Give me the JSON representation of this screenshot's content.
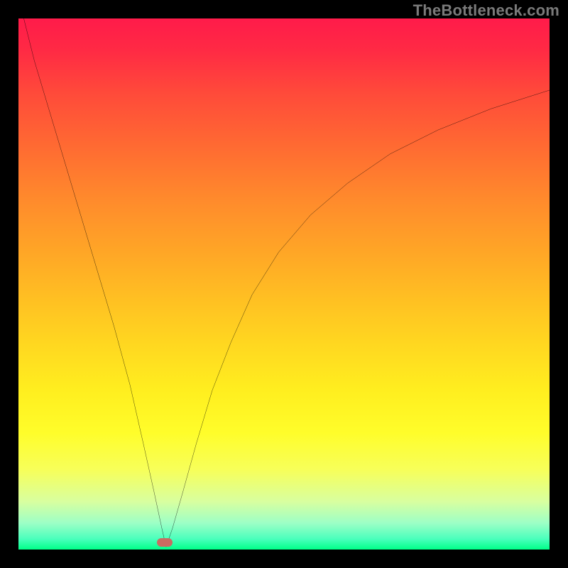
{
  "watermark": "TheBottleneck.com",
  "colors": {
    "background": "#000000",
    "gradient_top": "#ff1b4a",
    "gradient_bottom": "#00ff88",
    "curve": "#000000",
    "marker": "#c96b61",
    "watermark": "#7a7a7a"
  },
  "chart_data": {
    "type": "line",
    "title": "",
    "xlabel": "",
    "ylabel": "",
    "xlim": [
      0,
      100
    ],
    "ylim": [
      0,
      100
    ],
    "grid": false,
    "legend": false,
    "series": [
      {
        "name": "left-branch",
        "x": [
          1,
          3,
          6,
          9,
          12,
          15,
          18,
          21,
          23.5,
          25.5,
          27,
          27.8
        ],
        "y": [
          100,
          92,
          82,
          72,
          62,
          52,
          42,
          31,
          20,
          11,
          4,
          0.5
        ]
      },
      {
        "name": "right-branch",
        "x": [
          27.8,
          29,
          31,
          33.5,
          36.5,
          40,
          44,
          49,
          55,
          62,
          70,
          79,
          89,
          100
        ],
        "y": [
          0.5,
          4,
          11,
          20,
          30,
          39,
          48,
          56,
          63,
          69,
          74.5,
          79,
          83,
          86.5
        ]
      }
    ],
    "annotations": [
      {
        "name": "min-marker",
        "x": 27.5,
        "y": 1.3
      }
    ]
  }
}
